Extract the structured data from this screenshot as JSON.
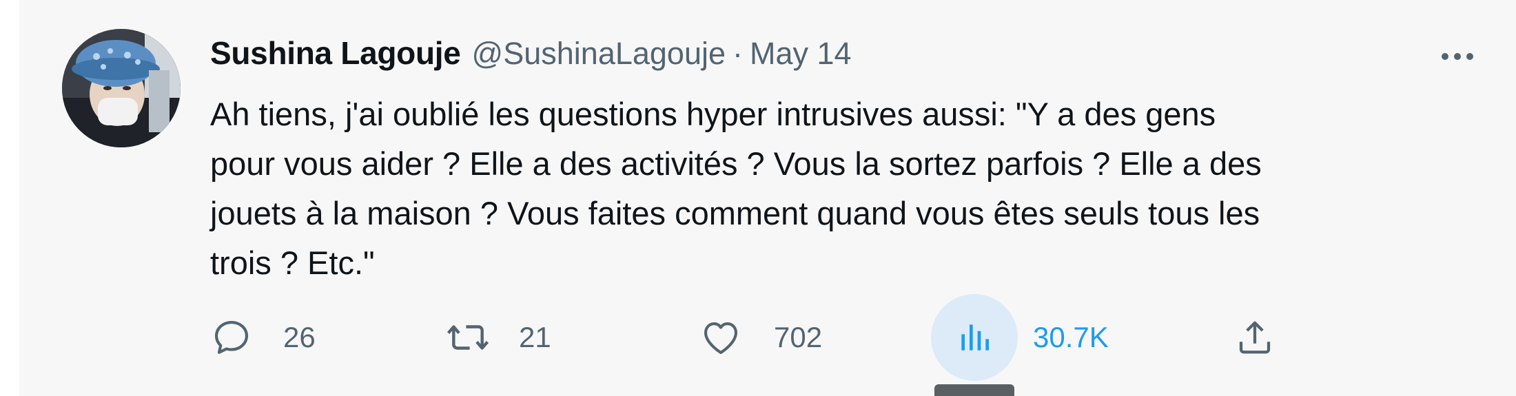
{
  "tweet": {
    "author_name": "Sushina Lagouje",
    "handle": "@SushinaLagouje",
    "separator": "·",
    "date": "May 14",
    "more_icon": "more-horizontal-icon",
    "text": "Ah tiens, j'ai oublié les questions hyper intrusives aussi: \"Y a des gens\npour vous aider ? Elle a des activités ? Vous la sortez parfois ? Elle a des\njouets à la maison ? Vous faites comment quand vous êtes seuls tous les\ntrois ? Etc.\""
  },
  "actions": {
    "reply": {
      "icon": "reply-icon",
      "count": "26"
    },
    "retweet": {
      "icon": "retweet-icon",
      "count": "21"
    },
    "like": {
      "icon": "heart-icon",
      "count": "702"
    },
    "views": {
      "icon": "views-chart-icon",
      "count": "30.7K"
    },
    "share": {
      "icon": "share-icon"
    }
  },
  "colors": {
    "text_primary": "#0f1419",
    "text_secondary": "#536471",
    "accent": "#1d9bf0",
    "background": "#f7f7f7"
  }
}
